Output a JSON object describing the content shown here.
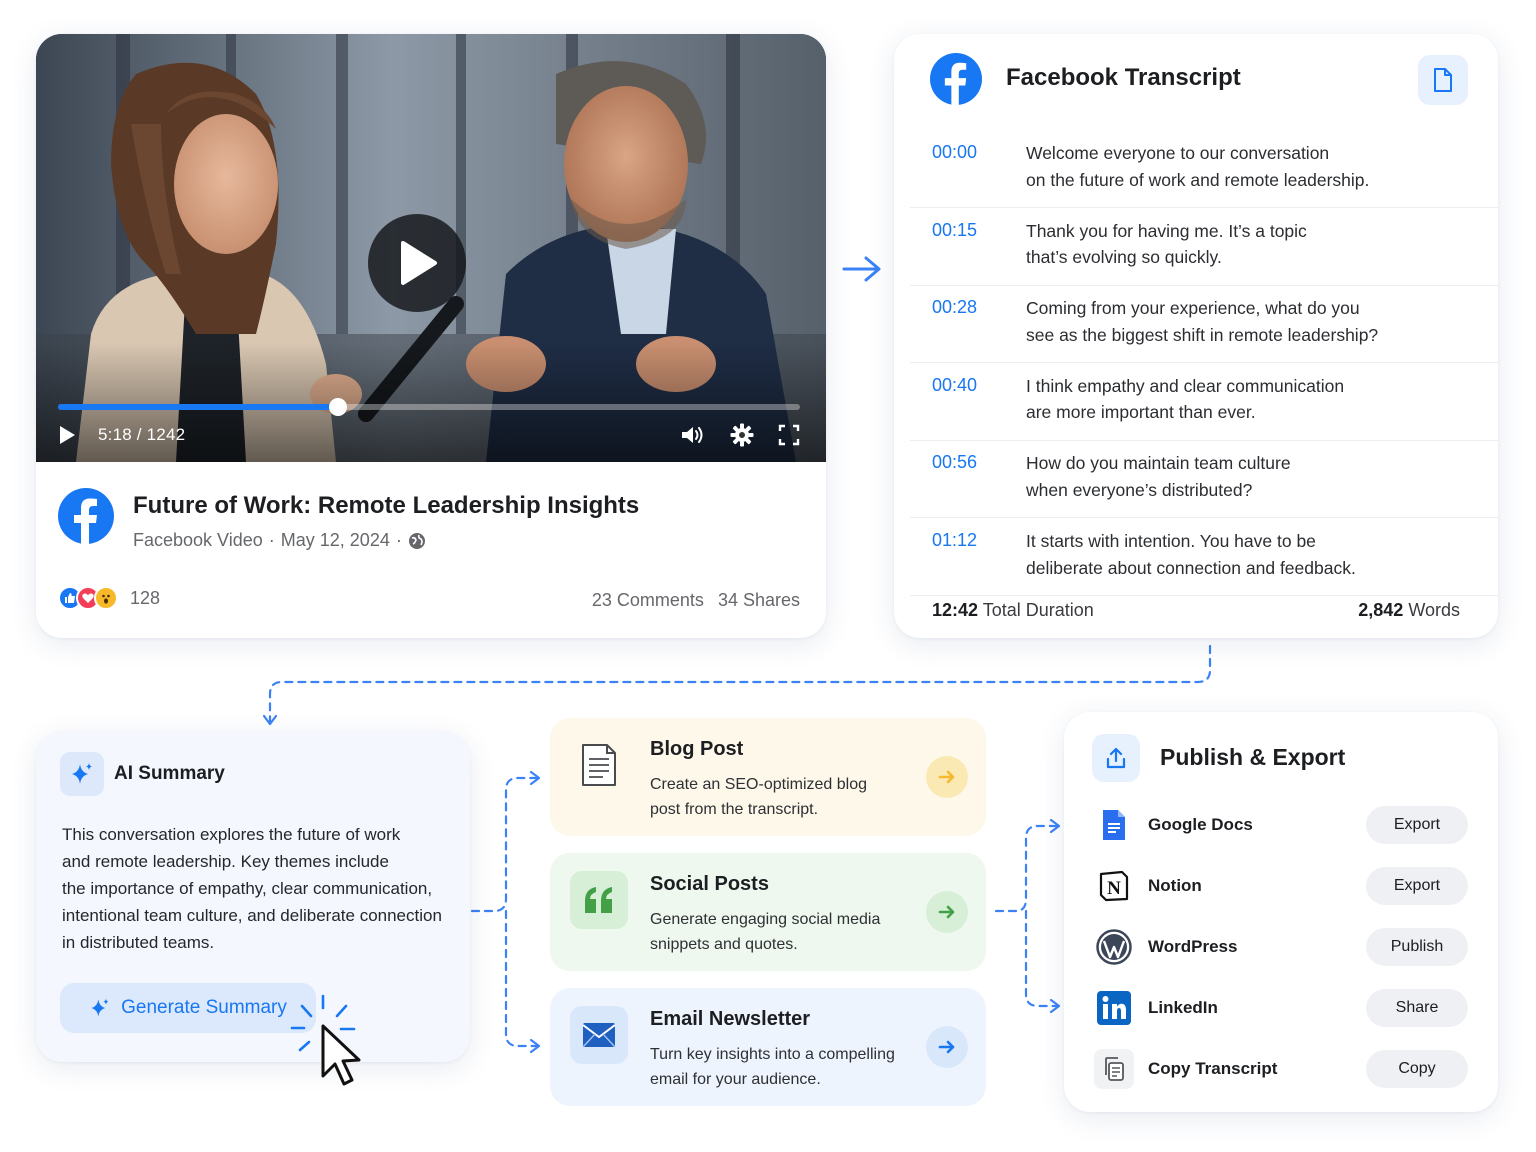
{
  "video": {
    "time": "5:18 / 1242",
    "progress": 0.377,
    "title": "Future of Work: Remote Leadership Insights",
    "source": "Facebook Video",
    "date": "May 12, 2024",
    "reaction_count": "128",
    "comments": "23 Comments",
    "shares": "34 Shares",
    "icons": [
      "play-icon",
      "volume-icon",
      "settings-icon",
      "fullscreen-icon",
      "globe-icon",
      "facebook-logo"
    ]
  },
  "transcript": {
    "title": "Facebook Transcript",
    "lines": [
      {
        "time": "00:00",
        "text1": "Welcome everyone to our conversation",
        "text2": "on the future of work and remote leadership."
      },
      {
        "time": "00:15",
        "text1": "Thank you for having me. It’s a topic",
        "text2": "that’s evolving so quickly."
      },
      {
        "time": "00:28",
        "text1": "Coming from your experience, what do you",
        "text2": "see as the biggest shift in remote leadership?"
      },
      {
        "time": "00:40",
        "text1": "I think empathy and clear communication",
        "text2": "are more important than ever."
      },
      {
        "time": "00:56",
        "text1": "How do you maintain team culture",
        "text2": "when everyone’s distributed?"
      },
      {
        "time": "01:12",
        "text1": "It starts with intention. You have to be",
        "text2": "deliberate about connection and feedback."
      }
    ],
    "duration_value": "12:42",
    "duration_label": "Total Duration",
    "words_value": "2,842",
    "words_label": "Words"
  },
  "summary": {
    "title": "AI Summary",
    "lines": [
      "This conversation explores the future of work",
      "and remote leadership. Key themes include",
      "the importance of empathy, clear communication,",
      "intentional team culture, and deliberate connection",
      "in distributed teams."
    ],
    "button": "Generate Summary"
  },
  "actions": [
    {
      "title": "Blog Post",
      "desc1": "Create an SEO-optimized blog",
      "desc2": "post from the transcript.",
      "accent": "#f5b82e"
    },
    {
      "title": "Social Posts",
      "desc1": "Generate engaging social media",
      "desc2": "snippets and quotes.",
      "accent": "#43a047"
    },
    {
      "title": "Email Newsletter",
      "desc1": "Turn key insights into a compelling",
      "desc2": "email for your audience.",
      "accent": "#1877f2"
    }
  ],
  "publish": {
    "title": "Publish & Export",
    "targets": [
      {
        "name": "Google Docs",
        "action": "Export"
      },
      {
        "name": "Notion",
        "action": "Export"
      },
      {
        "name": "WordPress",
        "action": "Publish"
      },
      {
        "name": "LinkedIn",
        "action": "Share"
      },
      {
        "name": "Copy Transcript",
        "action": "Copy"
      }
    ]
  },
  "colors": {
    "brand": "#1877f2",
    "connector": "#3b82f6"
  }
}
